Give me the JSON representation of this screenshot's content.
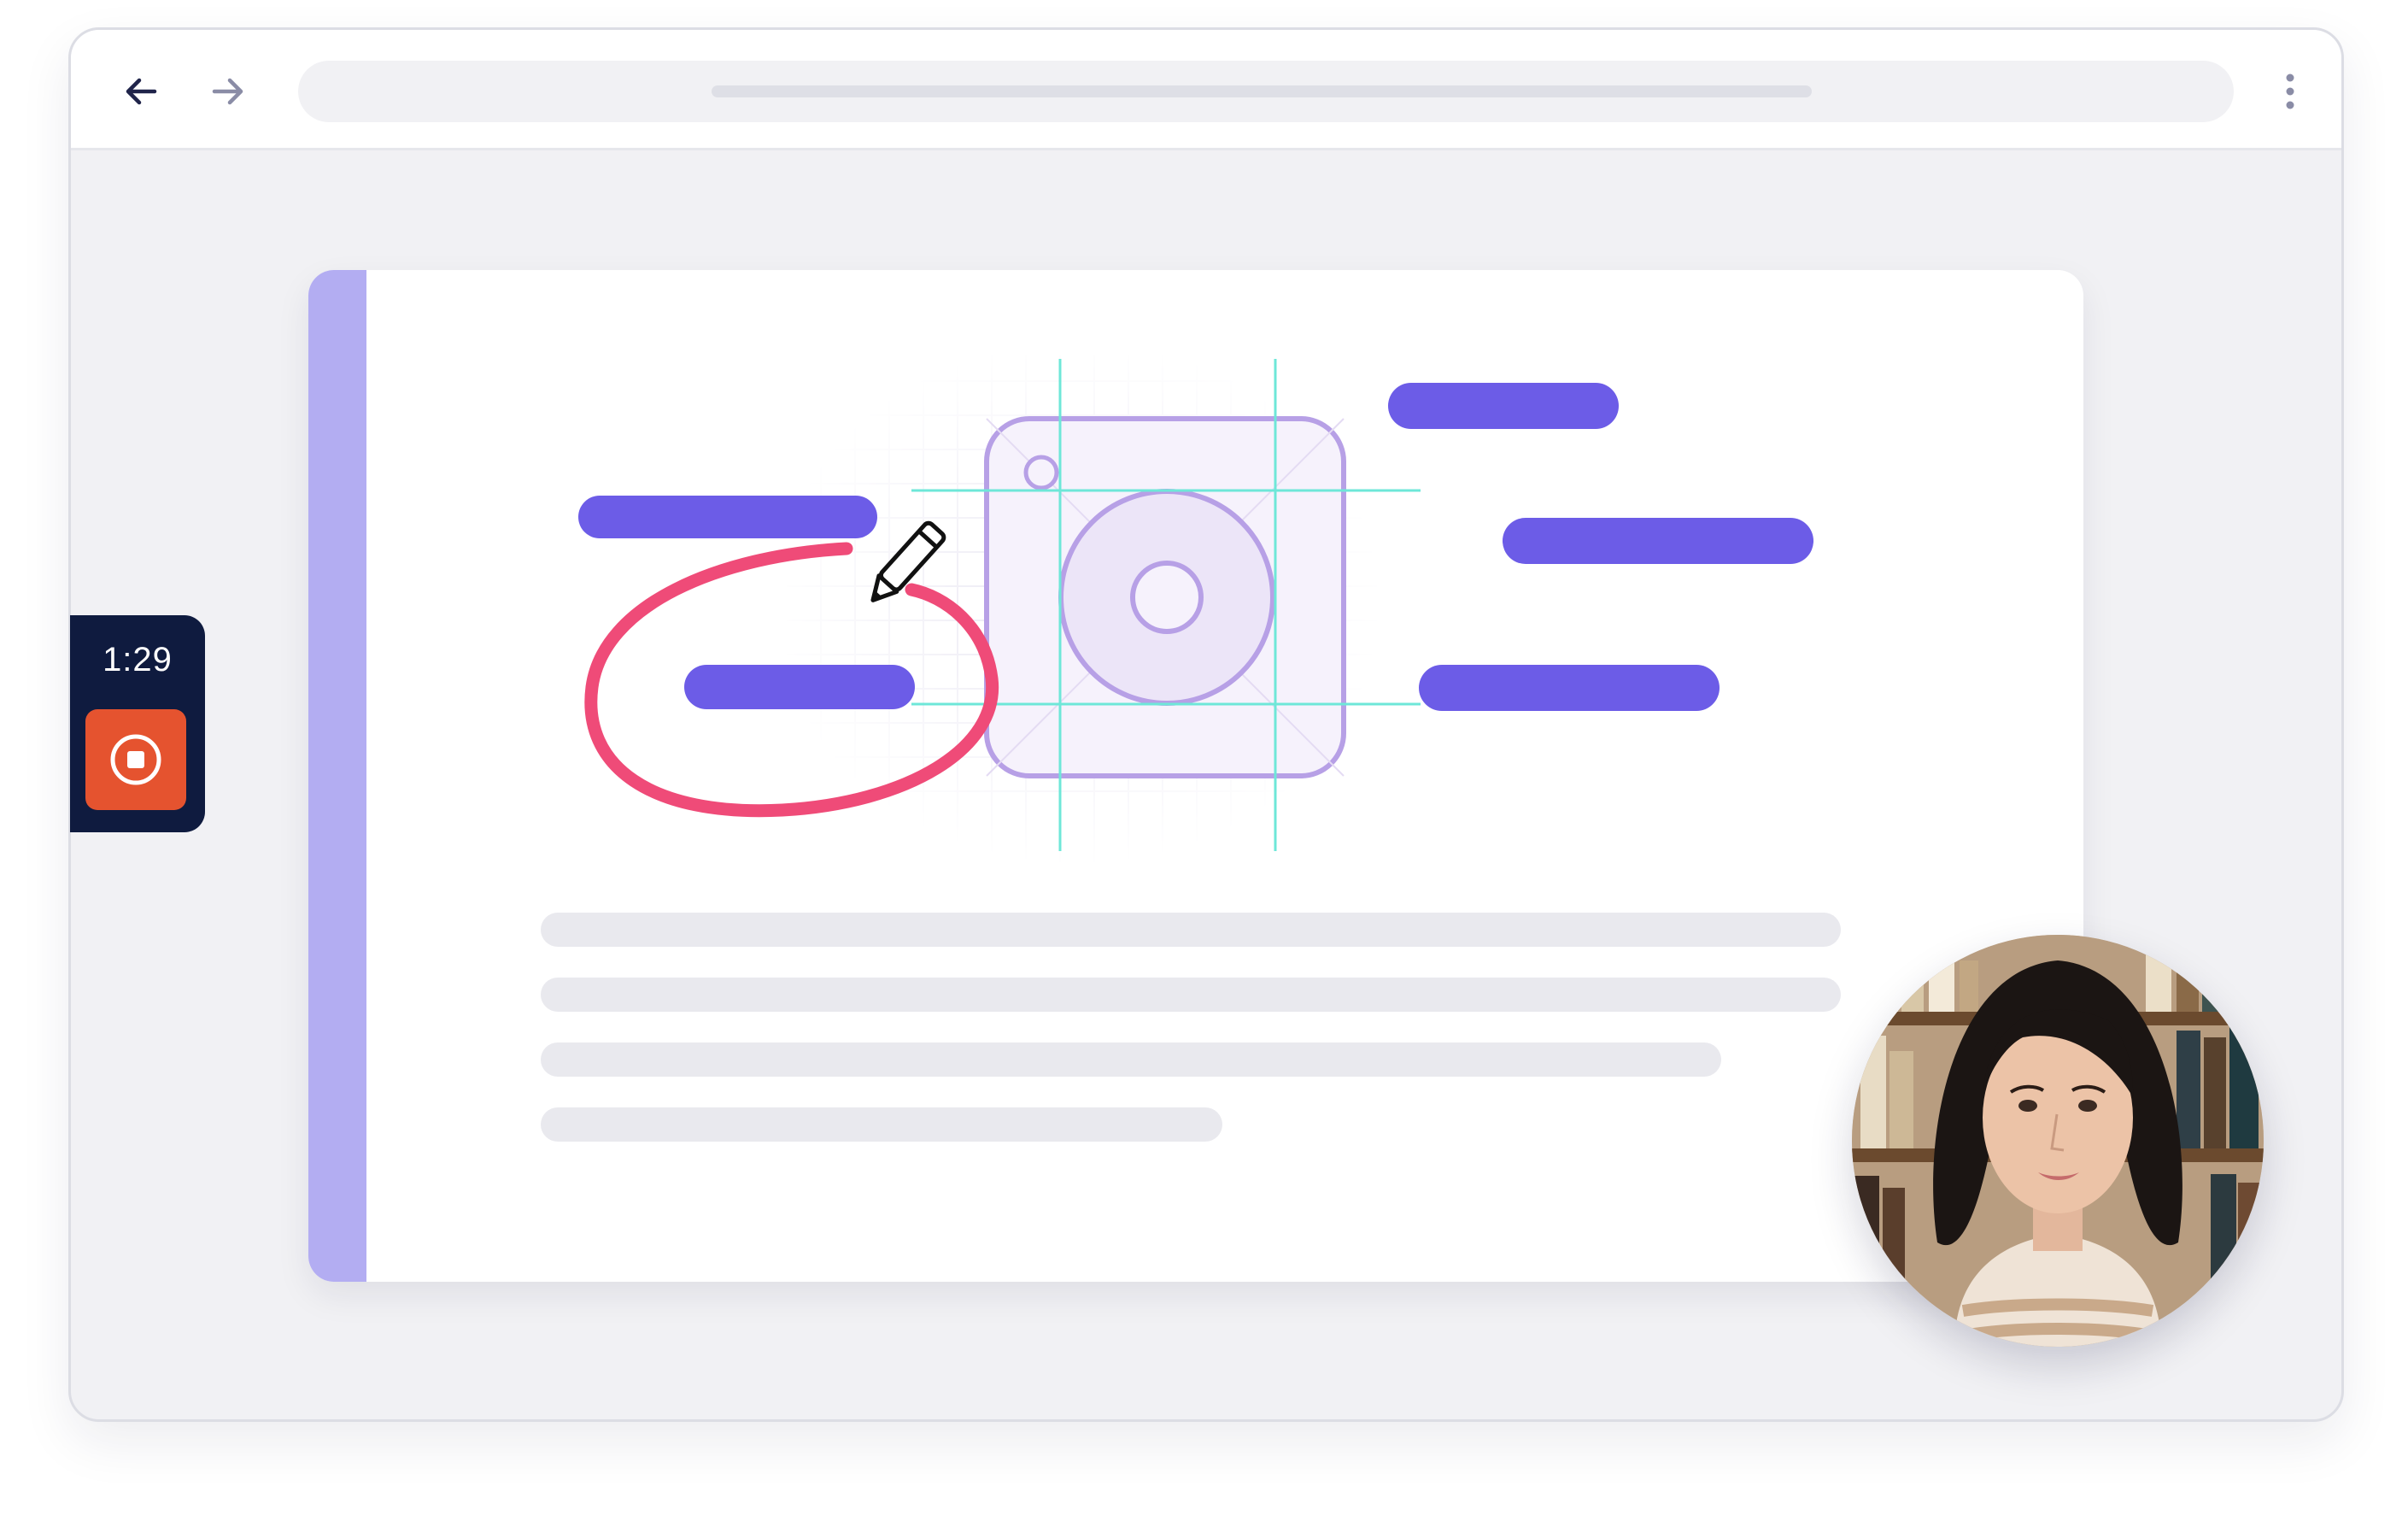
{
  "recorder": {
    "timer": "1:29",
    "stop_icon": "stop-circle-icon",
    "stop_color": "#e5532f",
    "background": "#0f1b3f"
  },
  "toolbar": {
    "back_icon": "arrow-left-icon",
    "forward_icon": "arrow-right-icon",
    "menu_icon": "kebab-menu-icon"
  },
  "colors": {
    "accent": "#6c5ce7",
    "annotation": "#ef4b78",
    "guide": "#6ee7d8",
    "icon_outline": "#b7a0e6",
    "sidebar": "#b3adf2"
  },
  "document": {
    "illustration_icon": "camera-app-icon",
    "annotation_icon": "pencil-icon"
  }
}
